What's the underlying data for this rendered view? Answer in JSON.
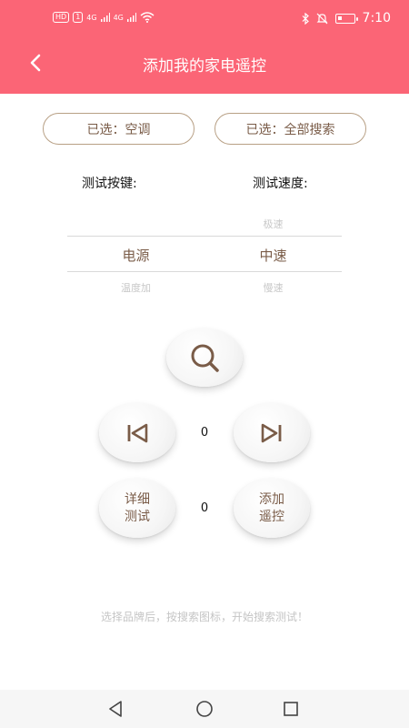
{
  "status_bar": {
    "hd": "HD",
    "sim1": "1",
    "net1": "4G",
    "net2": "4G",
    "time": "7:10",
    "icons": [
      "wifi-icon",
      "bluetooth-icon",
      "mute-bell-icon",
      "battery-icon"
    ]
  },
  "header": {
    "title": "添加我的家电遥控",
    "bg_color": "#fb6576"
  },
  "filters": {
    "device": "已选：空调",
    "brand": "已选：全部搜索"
  },
  "labels": {
    "test_key": "测试按键:",
    "test_speed": "测试速度:"
  },
  "key_picker": {
    "above": "",
    "selected": "电源",
    "below": "温度加"
  },
  "speed_picker": {
    "above": "极速",
    "selected": "中速",
    "below": "慢速"
  },
  "controls": {
    "prev_count": "0",
    "detail_count": "0",
    "detail_label": "详细\n测试",
    "add_label": "添加\n遥控"
  },
  "hint": "选择品牌后，按搜索图标，开始搜索测试！",
  "accent_color": "#7a5c48"
}
